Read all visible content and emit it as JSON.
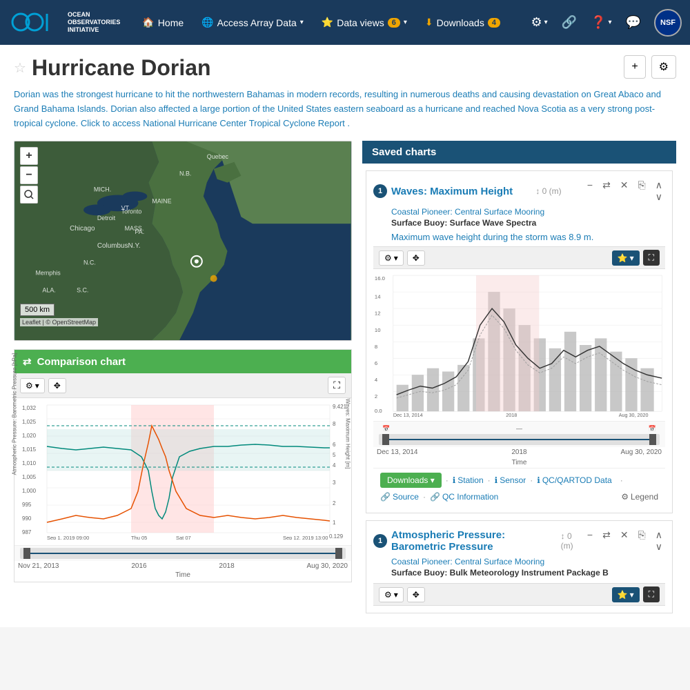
{
  "navbar": {
    "brand": {
      "name": "Ocean Observatories Initiative",
      "line1": "OCEAN",
      "line2": "OBSERVATORIES",
      "line3": "INITIATIVE"
    },
    "nav_items": [
      {
        "id": "home",
        "label": "Home",
        "icon": "🏠",
        "badge": null
      },
      {
        "id": "access-array-data",
        "label": "Access Array Data",
        "icon": "🌐",
        "badge": null
      },
      {
        "id": "data-views",
        "label": "Data views",
        "icon": "⭐",
        "badge": "6"
      },
      {
        "id": "downloads",
        "label": "Downloads",
        "icon": "⬇",
        "badge": "4"
      }
    ],
    "right_icons": [
      {
        "id": "settings",
        "icon": "⚙",
        "label": "Settings"
      },
      {
        "id": "share",
        "icon": "🔗",
        "label": "Share"
      },
      {
        "id": "help",
        "icon": "❓",
        "label": "Help"
      },
      {
        "id": "chat",
        "icon": "💬",
        "label": "Chat"
      }
    ]
  },
  "page": {
    "title": "Hurricane Dorian",
    "description": "Dorian was the strongest hurricane to hit the northwestern Bahamas in modern records, resulting in numerous deaths and causing devastation on Great Abaco and Grand Bahama Islands. Dorian also affected a large portion of the United States eastern seaboard as a hurricane and reached Nova Scotia as a very strong post-tropical cyclone. Click to access National Hurricane Center Tropical Cyclone Report ."
  },
  "actions": {
    "add_label": "+",
    "settings_label": "⚙"
  },
  "map": {
    "zoom_in": "+",
    "zoom_out": "−",
    "zoom_reset": "⊙",
    "scale_label": "500 km"
  },
  "comparison_chart": {
    "title": "Comparison chart",
    "icon": "⇄",
    "toolbar": {
      "settings": "⚙ ▾",
      "pan": "✥"
    },
    "y_left_label": "Atmospheric Pressure: Barometric Pressure [hPa]",
    "y_right_label": "Waves: Maximum Height [m]",
    "x_start": "Sep 1, 2019 09:00",
    "x_mid1": "Thu 05",
    "x_mid2": "Sat 07",
    "x_end": "Sep 12, 2019 13:00",
    "x_bottom_start": "Nov 21, 2013",
    "x_bottom_mid": "2016",
    "x_bottom_mid2": "2018",
    "x_bottom_end": "Aug 30, 2020",
    "x_label": "Time",
    "y_left_values": [
      "1,032",
      "1,025",
      "1,020",
      "1,015",
      "1,010",
      "1,005",
      "1,000",
      "995",
      "990",
      "987"
    ],
    "y_right_values": [
      "9.421",
      "8",
      "6",
      "5",
      "4",
      "3",
      "2",
      "1",
      "0.129"
    ]
  },
  "saved_charts": {
    "header": "Saved charts",
    "charts": [
      {
        "num": "1",
        "title": "Waves: Maximum Height",
        "offset": "↕ 0 (m)",
        "subtitle": "Coastal Pioneer: Central Surface Mooring",
        "instrument": "Surface Buoy: Surface Wave Spectra",
        "description": "Maximum wave height during the storm was 8.9 m.",
        "x_start": "Dec 13, 2014",
        "x_mid": "2018",
        "x_end": "Aug 30, 2020",
        "x_label": "Time",
        "x_bottom_start": "Dec 13, 2014",
        "x_bottom_mid": "2018",
        "x_bottom_end": "Aug 30, 2020",
        "y_top": "16.0",
        "y_values": [
          "14",
          "12",
          "10",
          "8",
          "6",
          "4",
          "2",
          "0.0"
        ],
        "y_unit": "m",
        "footer": {
          "downloads": "Downloads ▾",
          "station": "Station",
          "sensor": "Sensor",
          "qc_artod": "QC/QARTOD Data",
          "source": "Source",
          "qc_info": "QC Information",
          "legend": "Legend"
        }
      },
      {
        "num": "1",
        "title": "Atmospheric Pressure: Barometric Pressure",
        "offset": "↕ 0 (m)",
        "subtitle": "Coastal Pioneer: Central Surface Mooring",
        "instrument": "Surface Buoy: Bulk Meteorology Instrument Package B"
      }
    ]
  }
}
